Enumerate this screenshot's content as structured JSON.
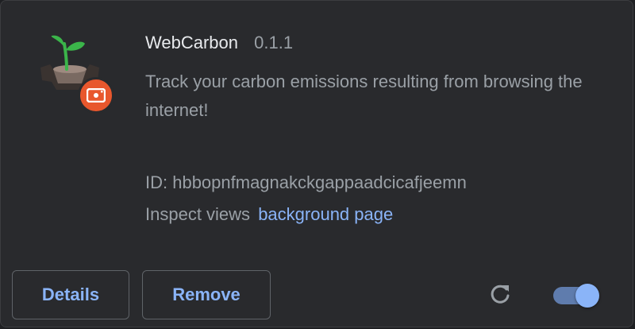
{
  "extension": {
    "name": "WebCarbon",
    "version": "0.1.1",
    "description": "Track your carbon emissions resulting from browsing the internet!",
    "id_label": "ID: hbbopnfmagnakckgappaadcicafjeemn",
    "inspect_label": "Inspect views",
    "inspect_link": "background page",
    "enabled": true
  },
  "buttons": {
    "details_label": "Details",
    "remove_label": "Remove"
  },
  "icons": {
    "extension": "plant-seedling-icon",
    "badge": "unpacked-badge-icon",
    "reload": "reload-icon"
  },
  "colors": {
    "background": "#292a2d",
    "link": "#8ab4f8",
    "title": "#e8eaed",
    "text": "#9aa0a6",
    "badge": "#e8572d"
  }
}
